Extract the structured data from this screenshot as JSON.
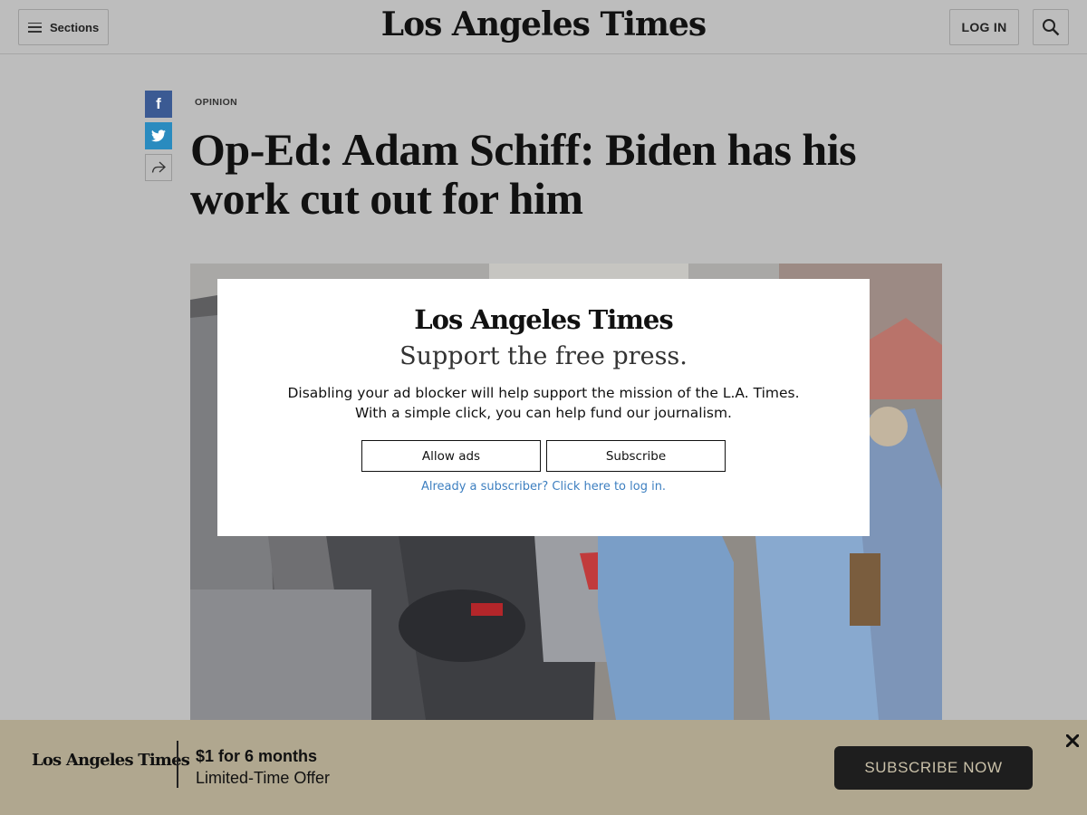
{
  "header": {
    "sections_label": "Sections",
    "masthead": "Los Angeles Times",
    "login_label": "LOG IN"
  },
  "share": {
    "facebook_glyph": "f"
  },
  "article": {
    "kicker": "OPINION",
    "headline": "Op-Ed: Adam Schiff: Biden has his work cut out for him"
  },
  "modal": {
    "logo": "Los Angeles Times",
    "title": "Support the free press.",
    "body_line1": "Disabling your ad blocker will help support the mission of the L.A. Times.",
    "body_line2": "With a simple click, you can help fund our journalism.",
    "allow_ads_label": "Allow ads",
    "subscribe_label": "Subscribe",
    "login_link": "Already a subscriber? Click here to log in."
  },
  "banner": {
    "logo": "Los Angeles Times",
    "price": "$1 for 6 months",
    "offer": "Limited-Time Offer",
    "cta_label": "SUBSCRIBE NOW"
  },
  "colors": {
    "facebook": "#3b5a93",
    "twitter": "#2a8bbf",
    "link": "#3d7fc0",
    "banner_bg": "#b0a78f",
    "cta_bg": "#1e1e1e"
  },
  "icons": [
    "hamburger-icon",
    "search-icon",
    "facebook-icon",
    "twitter-icon",
    "share-arrow-icon",
    "close-icon"
  ]
}
